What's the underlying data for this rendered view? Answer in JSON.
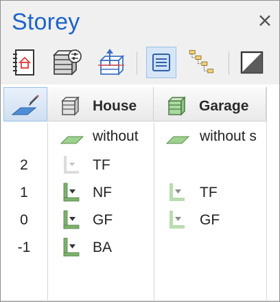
{
  "window": {
    "title": "Storey",
    "close_glyph": "×"
  },
  "toolbar": {
    "buttons": [
      {
        "icon": "storey-book-icon"
      },
      {
        "icon": "building-settings-icon"
      },
      {
        "icon": "building-3d-icon"
      },
      {
        "icon": "list-view-icon",
        "active": true
      },
      {
        "icon": "tree-hierarchy-icon"
      },
      {
        "icon": "half-tone-icon"
      }
    ]
  },
  "header": {
    "buildings": [
      {
        "label": "House",
        "icon_color": "#d9d9d9"
      },
      {
        "label": "Garage",
        "icon_color": "#a9d8a0"
      }
    ]
  },
  "rows": [
    {
      "number": "",
      "house": {
        "label": "without",
        "type": "plane"
      },
      "garage": {
        "label": "without s",
        "type": "plane"
      }
    },
    {
      "number": "2",
      "house": {
        "label": "TF",
        "type": "storey-faded"
      },
      "garage": null
    },
    {
      "number": "1",
      "house": {
        "label": "NF",
        "type": "storey"
      },
      "garage": {
        "label": "TF",
        "type": "storey-light"
      }
    },
    {
      "number": "0",
      "house": {
        "label": "GF",
        "type": "storey"
      },
      "garage": {
        "label": "GF",
        "type": "storey-light"
      }
    },
    {
      "number": "-1",
      "house": {
        "label": "BA",
        "type": "storey"
      },
      "garage": null
    }
  ],
  "colors": {
    "title": "#1e63c8",
    "green_plane": "#9ed08f",
    "storey_green": "#7db36c"
  }
}
